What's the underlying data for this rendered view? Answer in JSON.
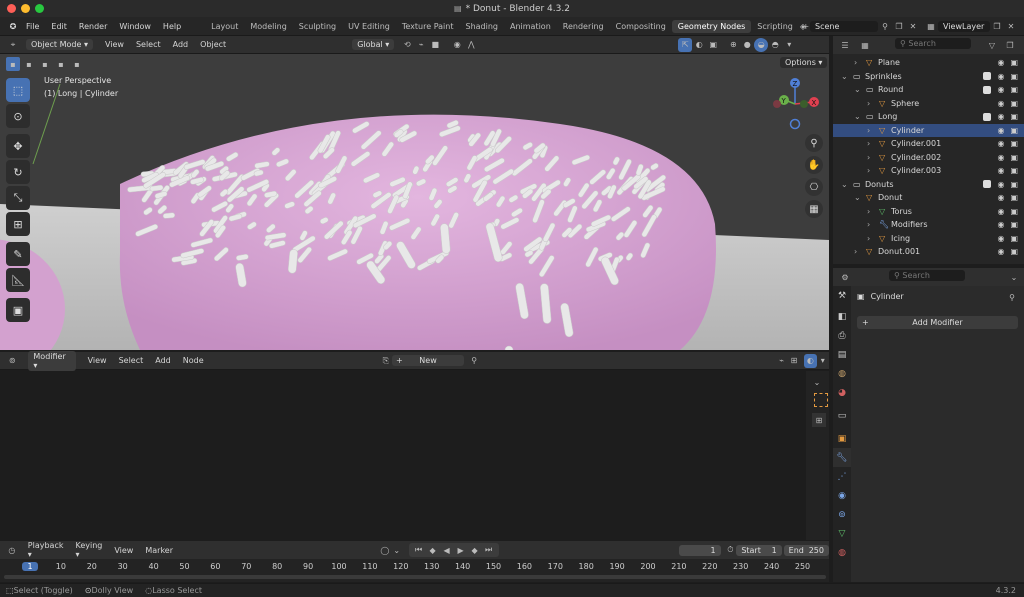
{
  "title": "* Donut - Blender 4.3.2",
  "menu": [
    "File",
    "Edit",
    "Render",
    "Window",
    "Help"
  ],
  "workspaces": [
    "Layout",
    "Modeling",
    "Sculpting",
    "UV Editing",
    "Texture Paint",
    "Shading",
    "Animation",
    "Rendering",
    "Compositing",
    "Geometry Nodes",
    "Scripting"
  ],
  "active_workspace": "Geometry Nodes",
  "scene": "Scene",
  "view_layer": "ViewLayer",
  "viewport": {
    "mode": "Object Mode",
    "menus": [
      "View",
      "Select",
      "Add",
      "Object"
    ],
    "transform": "Global",
    "options": "Options",
    "perspective": "User Perspective",
    "selection": "(1) Long | Cylinder"
  },
  "outliner": {
    "search_placeholder": "Search",
    "items": [
      {
        "label": "Plane",
        "indent": 1
      },
      {
        "label": "Sprinkles",
        "indent": 0
      },
      {
        "label": "Round",
        "indent": 1
      },
      {
        "label": "Sphere",
        "indent": 2
      },
      {
        "label": "Long",
        "indent": 1
      },
      {
        "label": "Cylinder",
        "indent": 2
      },
      {
        "label": "Cylinder.001",
        "indent": 2
      },
      {
        "label": "Cylinder.002",
        "indent": 2
      },
      {
        "label": "Cylinder.003",
        "indent": 2
      },
      {
        "label": "Donuts",
        "indent": 0
      },
      {
        "label": "Donut",
        "indent": 1
      },
      {
        "label": "Torus",
        "indent": 2
      },
      {
        "label": "Modifiers",
        "indent": 2
      },
      {
        "label": "Icing",
        "indent": 2
      },
      {
        "label": "Donut.001",
        "indent": 1
      }
    ]
  },
  "properties": {
    "search_placeholder": "Search",
    "object_name": "Cylinder",
    "add_modifier": "Add Modifier"
  },
  "node_editor": {
    "type": "Modifier",
    "menus": [
      "View",
      "Select",
      "Add",
      "Node"
    ],
    "new_label": "New"
  },
  "timeline": {
    "menus": [
      "Playback",
      "Keying",
      "View",
      "Marker"
    ],
    "current_frame": "1",
    "start_label": "Start",
    "start": "1",
    "end_label": "End",
    "end": "250",
    "ticks": [
      "1",
      "10",
      "20",
      "30",
      "40",
      "50",
      "60",
      "70",
      "80",
      "90",
      "100",
      "110",
      "120",
      "130",
      "140",
      "150",
      "160",
      "170",
      "180",
      "190",
      "200",
      "210",
      "220",
      "230",
      "240",
      "250"
    ]
  },
  "status": {
    "items": [
      "Select (Toggle)",
      "Dolly View",
      "Lasso Select"
    ],
    "version": "4.3.2"
  },
  "colors": {
    "accent": "#4772b3",
    "icing": "#d9a6d6",
    "sprinkle": "#e8e8e8"
  }
}
